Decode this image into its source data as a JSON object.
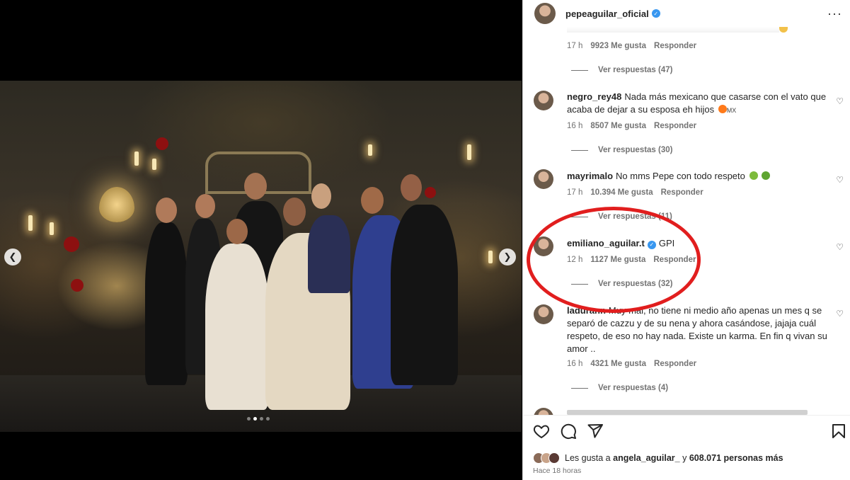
{
  "header": {
    "username": "pepeaguilar_oficial",
    "verified": true,
    "more_icon": "more-horizontal-icon"
  },
  "media": {
    "prev_icon": "chevron-left-icon",
    "next_icon": "chevron-right-icon",
    "dots": 4,
    "active_dot": 1
  },
  "comments": [
    {
      "user": "",
      "text": "",
      "time": "17 h",
      "likes": "9923 Me gusta",
      "reply": "Responder",
      "view_replies": "Ver respuestas (47)"
    },
    {
      "user": "negro_rey48",
      "text": "Nada más mexicano que casarse con el vato que acaba de dejar a su esposa eh hijos",
      "badge": "MX",
      "time": "16 h",
      "likes": "8507 Me gusta",
      "reply": "Responder",
      "view_replies": "Ver respuestas (30)"
    },
    {
      "user": "mayrimalo",
      "text": "No mms Pepe con todo respeto",
      "time": "17 h",
      "likes": "10.394 Me gusta",
      "reply": "Responder",
      "view_replies": "Ver respuestas (11)"
    },
    {
      "user": "emiliano_aguilar.t",
      "verified": true,
      "text": "GPI",
      "time": "12 h",
      "likes": "1127 Me gusta",
      "reply": "Responder",
      "view_replies": "Ver respuestas (32)"
    },
    {
      "user": "ladurann",
      "text": "Muy mal, no tiene ni medio año apenas un mes q se separó de cazzu y de su nena y ahora casándose, jajaja cuál respeto, de eso no hay nada. Existe un karma. En fin q vivan su amor ..",
      "time": "16 h",
      "likes": "4321 Me gusta",
      "reply": "Responder",
      "view_replies": "Ver respuestas (4)"
    }
  ],
  "actions": {
    "like_icon": "heart-icon",
    "comment_icon": "comment-icon",
    "share_icon": "send-icon",
    "save_icon": "bookmark-icon"
  },
  "likes": {
    "prefix": "Les gusta a",
    "user": "angela_aguilar_",
    "middle": "y",
    "count": "608.071 personas más"
  },
  "timestamp": "Hace 18 horas",
  "colors": {
    "highlight": "#e11e1e",
    "verified": "#3897f0",
    "muted": "#737373"
  }
}
